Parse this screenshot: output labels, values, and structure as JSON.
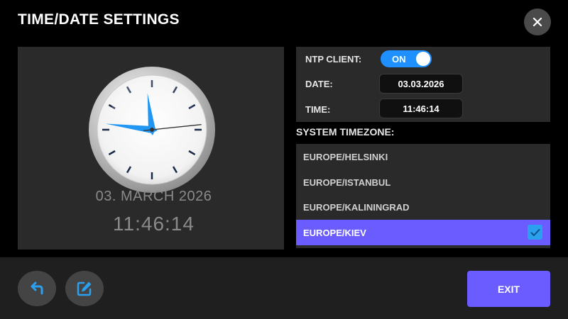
{
  "header": {
    "title": "TIME/DATE SETTINGS",
    "close_icon": "close-icon"
  },
  "clock": {
    "hour": 11,
    "minute": 46,
    "second": 14,
    "hand_color": "#2196f3",
    "date_display": "03. MARCH 2026",
    "time_display": "11:46:14"
  },
  "settings": {
    "ntp_label": "NTP CLIENT:",
    "ntp_state": "ON",
    "ntp_enabled": true,
    "date_label": "DATE:",
    "date_value": "03.03.2026",
    "time_label": "TIME:",
    "time_value": "11:46:14"
  },
  "timezone": {
    "heading": "SYSTEM TIMEZONE:",
    "items": [
      {
        "label": "EUROPE/HELSINKI",
        "selected": false
      },
      {
        "label": "EUROPE/ISTANBUL",
        "selected": false
      },
      {
        "label": "EUROPE/KALININGRAD",
        "selected": false
      },
      {
        "label": "EUROPE/KIEV",
        "selected": true
      }
    ],
    "selected_color": "#6a5cff"
  },
  "footer": {
    "back_icon": "undo-arrow-icon",
    "edit_icon": "edit-icon",
    "exit_label": "EXIT"
  }
}
